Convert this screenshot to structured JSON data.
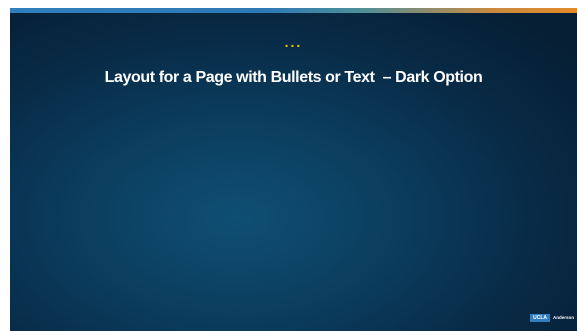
{
  "slide": {
    "ellipsis": "...",
    "title": "Layout for a Page with Bullets or Text  – Dark Option"
  },
  "logo": {
    "box_text": "UCLA",
    "text": "Anderson"
  },
  "colors": {
    "background": "#0b3d5e",
    "accent_bar_start": "#2f7fbd",
    "accent_bar_end": "#e3892b",
    "ellipsis": "#f2c200",
    "title": "#ffffff"
  }
}
